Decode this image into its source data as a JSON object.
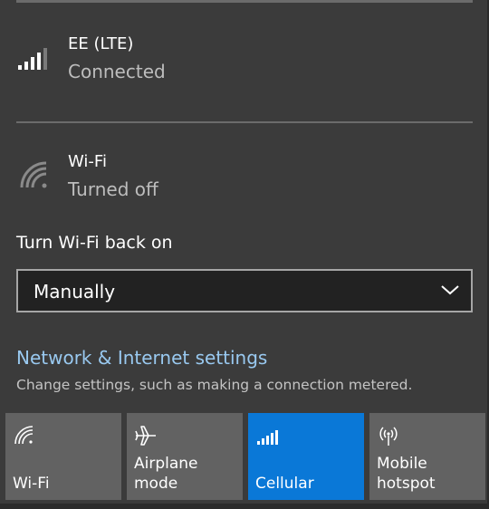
{
  "cellular": {
    "name": "EE (LTE)",
    "status": "Connected"
  },
  "wifi": {
    "name": "Wi-Fi",
    "status": "Turned off"
  },
  "turn_back_on": {
    "label": "Turn Wi-Fi back on",
    "selected": "Manually"
  },
  "settings": {
    "link": "Network & Internet settings",
    "description": "Change settings, such as making a connection metered."
  },
  "tiles": [
    {
      "label": "Wi-Fi",
      "icon": "wifi-icon",
      "active": false
    },
    {
      "label": "Airplane mode",
      "icon": "airplane-icon",
      "active": false
    },
    {
      "label": "Cellular",
      "icon": "cellular-signal-icon",
      "active": true
    },
    {
      "label": "Mobile hotspot",
      "icon": "hotspot-icon",
      "active": false
    }
  ],
  "colors": {
    "background": "#3b3b3b",
    "tile": "#626262",
    "tile_active": "#0a78d7",
    "link": "#99c9f0"
  }
}
